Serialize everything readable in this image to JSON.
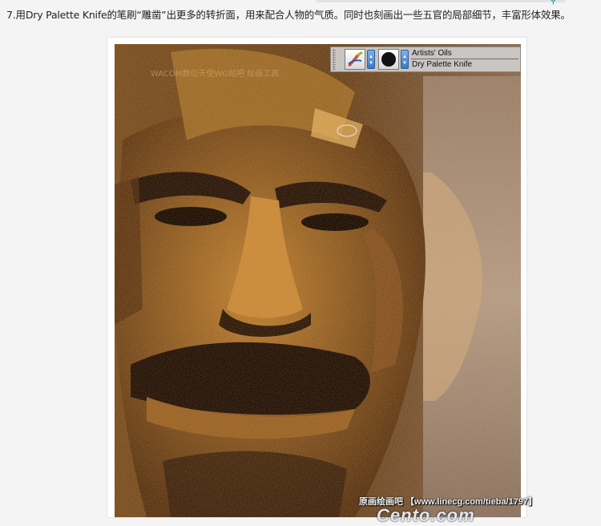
{
  "caption": "7.用Dry Palette Knife的笔刷“雕凿”出更多的转折面，用来配合人物的气质。同时也刻画出一些五官的局部细节，丰富形体效果。",
  "painting": {
    "watermark_top": "WACOM数位天使WG贴吧 绘画工具",
    "bottom_watermark": "原画绘画吧 【www.linecg.com/tieba/1797】",
    "bottom_logo": "Cento.com"
  },
  "brush_panel": {
    "category": "Artists' Oils",
    "variant": "Dry Palette Knife",
    "category_icon": "palette-knife-icon",
    "variant_icon": "round-brush-dab-icon"
  },
  "colors": {
    "background": "#f4f4f4",
    "panel": "#c8c5c2",
    "accent": "#3c78c4",
    "painting_light": "#d9a24a",
    "painting_dark": "#2a170b"
  }
}
